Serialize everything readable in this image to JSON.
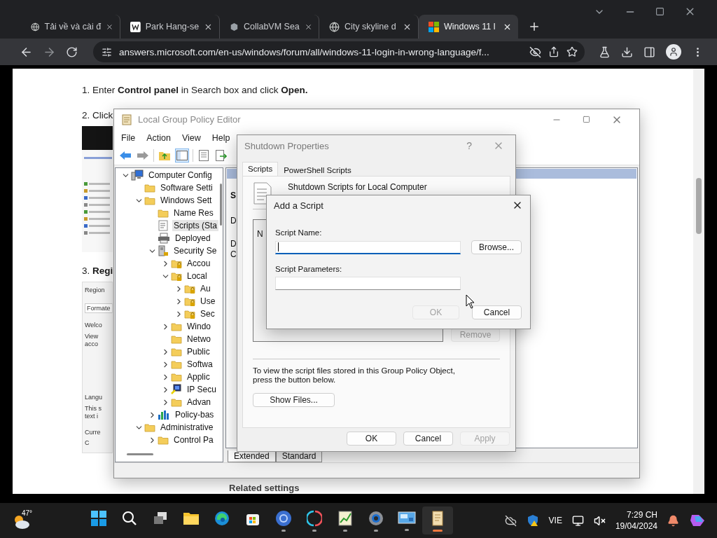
{
  "browser": {
    "tabs": [
      {
        "kind": "globe",
        "title": "Tải về và cài đ",
        "selected": false
      },
      {
        "kind": "wiki",
        "title": "Park Hang-se",
        "selected": false
      },
      {
        "kind": "collab",
        "title": "CollabVM Sea",
        "selected": false
      },
      {
        "kind": "globe",
        "title": "City skyline d",
        "selected": false
      },
      {
        "kind": "windows",
        "title": "Windows 11 l",
        "selected": true
      }
    ],
    "url": "answers.microsoft.com/en-us/windows/forum/all/windows-11-login-in-wrong-language/f..."
  },
  "article": {
    "blocks": [
      {
        "kind": "text",
        "text": "1. Enter **Control panel** in Search box and click **Open.**"
      },
      {
        "kind": "text",
        "text": "2. Click"
      },
      {
        "kind": "control_panel_shot"
      },
      {
        "kind": "text",
        "text": "3. **Regi**"
      },
      {
        "kind": "region_shot",
        "labels": [
          "Region",
          "Formate",
          "Welco",
          "View",
          "acco",
          "Langu",
          "This s",
          "text i",
          "Curre",
          "C"
        ]
      }
    ],
    "footer": "Related settings"
  },
  "policy_editor": {
    "title": "Local Group Policy Editor",
    "menu": [
      "File",
      "Action",
      "View",
      "Help"
    ],
    "tree": [
      {
        "label": "Computer Config",
        "kind": "computer",
        "selected": false,
        "expanded": true,
        "children": [
          {
            "label": "Software Setti",
            "kind": "folder",
            "selected": false
          },
          {
            "label": "Windows Sett",
            "kind": "folder",
            "selected": false,
            "expanded": true,
            "children": [
              {
                "label": "Name Res",
                "kind": "folder",
                "selected": false
              },
              {
                "label": "Scripts (Sta",
                "kind": "script",
                "selected": true
              },
              {
                "label": "Deployed",
                "kind": "printer",
                "selected": false
              },
              {
                "label": "Security Se",
                "kind": "server",
                "selected": false,
                "expanded": true,
                "children": [
                  {
                    "label": "Accou",
                    "kind": "locked",
                    "selected": false,
                    "expanded": false
                  },
                  {
                    "label": "Local",
                    "kind": "locked",
                    "selected": false,
                    "expanded": true,
                    "children": [
                      {
                        "label": "Au",
                        "kind": "locked",
                        "selected": false,
                        "expanded": false
                      },
                      {
                        "label": "Use",
                        "kind": "locked",
                        "selected": false,
                        "expanded": false
                      },
                      {
                        "label": "Sec",
                        "kind": "locked",
                        "selected": false,
                        "expanded": false
                      }
                    ]
                  },
                  {
                    "label": "Windo",
                    "kind": "folder",
                    "selected": false,
                    "expanded": false
                  },
                  {
                    "label": "Netwo",
                    "kind": "folder",
                    "selected": false
                  },
                  {
                    "label": "Public",
                    "kind": "folder",
                    "selected": false,
                    "expanded": false
                  },
                  {
                    "label": "Softwa",
                    "kind": "folder",
                    "selected": false,
                    "expanded": false
                  },
                  {
                    "label": "Applic",
                    "kind": "folder",
                    "selected": false,
                    "expanded": false
                  },
                  {
                    "label": "IP Secu",
                    "kind": "network",
                    "selected": false,
                    "expanded": false
                  },
                  {
                    "label": "Advan",
                    "kind": "folder",
                    "selected": false,
                    "expanded": false
                  }
                ]
              },
              {
                "label": "Policy-bas",
                "kind": "chart",
                "selected": false,
                "expanded": false
              }
            ]
          },
          {
            "label": "Administrative",
            "kind": "folder",
            "selected": false,
            "expanded": true,
            "children": [
              {
                "label": "Control Pa",
                "kind": "folder",
                "selected": false,
                "expanded": false
              }
            ]
          }
        ]
      }
    ],
    "details": [
      "S",
      "D",
      "D",
      "C"
    ],
    "view_tabs": [
      {
        "label": "Extended",
        "selected": true
      },
      {
        "label": "Standard",
        "selected": false
      }
    ]
  },
  "shutdown_dialog": {
    "title": "Shutdown Properties",
    "help": "?",
    "tabs": [
      {
        "label": "Scripts",
        "selected": true
      },
      {
        "label": "PowerShell Scripts",
        "selected": false
      }
    ],
    "heading": "Shutdown Scripts for Local Computer",
    "list_column": "N",
    "remove": {
      "label": "Remove",
      "disabled": true
    },
    "note": "To view the script files stored in this Group Policy Object, press the button below.",
    "show_files": "Show Files...",
    "buttons": [
      {
        "label": "OK",
        "disabled": false
      },
      {
        "label": "Cancel",
        "disabled": false
      },
      {
        "label": "Apply",
        "disabled": true
      }
    ]
  },
  "add_script_dialog": {
    "title": "Add a Script",
    "fields": [
      {
        "label": "Script Name:",
        "focused": true
      },
      {
        "label": "Script Parameters:",
        "focused": false
      }
    ],
    "browse": "Browse...",
    "buttons": [
      {
        "label": "OK",
        "disabled": true
      },
      {
        "label": "Cancel",
        "disabled": false
      }
    ]
  },
  "taskbar": {
    "weather": "47°",
    "apps": [
      {
        "kind": "start",
        "running": false,
        "active": false
      },
      {
        "kind": "search",
        "running": false,
        "active": false
      },
      {
        "kind": "taskview",
        "running": false,
        "active": false
      },
      {
        "kind": "explorer",
        "running": false,
        "active": false
      },
      {
        "kind": "edge",
        "running": false,
        "active": false
      },
      {
        "kind": "store",
        "running": false,
        "active": false
      },
      {
        "kind": "chrome",
        "running": true,
        "active": false
      },
      {
        "kind": "split",
        "running": true,
        "active": false
      },
      {
        "kind": "chartpad",
        "running": true,
        "active": false
      },
      {
        "kind": "settings",
        "running": true,
        "active": false
      },
      {
        "kind": "remote",
        "running": true,
        "active": false
      },
      {
        "kind": "scroll",
        "running": true,
        "active": true
      }
    ],
    "language": "VIE",
    "time": "7:29 CH",
    "date": "19/04/2024"
  }
}
